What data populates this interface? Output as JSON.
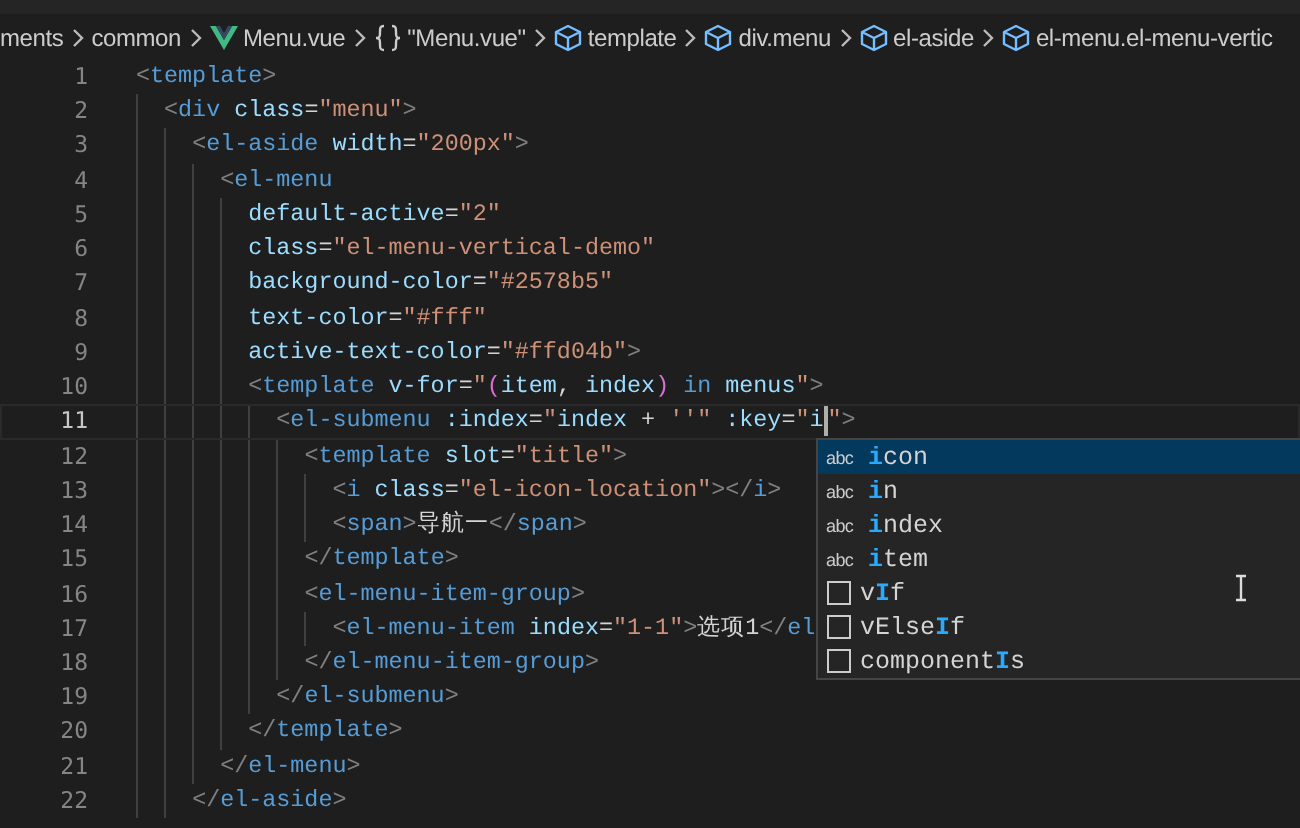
{
  "breadcrumbs": [
    {
      "kind": "text",
      "label": "ments"
    },
    {
      "kind": "text",
      "label": "common"
    },
    {
      "kind": "vue",
      "label": "Menu.vue"
    },
    {
      "kind": "braces",
      "label": "\"Menu.vue\""
    },
    {
      "kind": "symbol",
      "label": "template"
    },
    {
      "kind": "symbol",
      "label": "div.menu"
    },
    {
      "kind": "symbol",
      "label": "el-aside"
    },
    {
      "kind": "symbol",
      "label": "el-menu.el-menu-vertic"
    }
  ],
  "lines": [
    {
      "number": "1",
      "current": false,
      "tokens": [
        {
          "kind": "punct",
          "text": "<"
        },
        {
          "kind": "tag",
          "text": "template"
        },
        {
          "kind": "punct",
          "text": ">"
        }
      ]
    },
    {
      "number": "2",
      "current": false,
      "tokens": [
        {
          "kind": "punct",
          "text": "  <"
        },
        {
          "kind": "tag",
          "text": "div"
        },
        {
          "kind": "attr",
          "text": " class"
        },
        {
          "kind": "plain",
          "text": "="
        },
        {
          "kind": "string",
          "text": "\"menu\""
        },
        {
          "kind": "punct",
          "text": ">"
        }
      ]
    },
    {
      "number": "3",
      "current": false,
      "tokens": [
        {
          "kind": "punct",
          "text": "    <"
        },
        {
          "kind": "tag",
          "text": "el-aside"
        },
        {
          "kind": "attr",
          "text": " width"
        },
        {
          "kind": "plain",
          "text": "="
        },
        {
          "kind": "string",
          "text": "\"200px\""
        },
        {
          "kind": "punct",
          "text": ">"
        }
      ]
    },
    {
      "number": "4",
      "current": false,
      "tokens": [
        {
          "kind": "punct",
          "text": "      <"
        },
        {
          "kind": "tag",
          "text": "el-menu"
        }
      ]
    },
    {
      "number": "5",
      "current": false,
      "tokens": [
        {
          "kind": "attr",
          "text": "        default-active"
        },
        {
          "kind": "plain",
          "text": "="
        },
        {
          "kind": "string",
          "text": "\"2\""
        }
      ]
    },
    {
      "number": "6",
      "current": false,
      "tokens": [
        {
          "kind": "attr",
          "text": "        class"
        },
        {
          "kind": "plain",
          "text": "="
        },
        {
          "kind": "string",
          "text": "\"el-menu-vertical-demo\""
        }
      ]
    },
    {
      "number": "7",
      "current": false,
      "tokens": [
        {
          "kind": "attr",
          "text": "        background-color"
        },
        {
          "kind": "plain",
          "text": "="
        },
        {
          "kind": "string",
          "text": "\"#2578b5\""
        }
      ]
    },
    {
      "number": "8",
      "current": false,
      "tokens": [
        {
          "kind": "attr",
          "text": "        text-color"
        },
        {
          "kind": "plain",
          "text": "="
        },
        {
          "kind": "string",
          "text": "\"#fff\""
        }
      ]
    },
    {
      "number": "9",
      "current": false,
      "tokens": [
        {
          "kind": "attr",
          "text": "        active-text-color"
        },
        {
          "kind": "plain",
          "text": "="
        },
        {
          "kind": "string",
          "text": "\"#ffd04b\""
        },
        {
          "kind": "punct",
          "text": ">"
        }
      ]
    },
    {
      "number": "10",
      "current": false,
      "tokens": [
        {
          "kind": "punct",
          "text": "        <"
        },
        {
          "kind": "tag",
          "text": "template"
        },
        {
          "kind": "attr",
          "text": " v-for"
        },
        {
          "kind": "plain",
          "text": "="
        },
        {
          "kind": "string",
          "text": "\""
        },
        {
          "kind": "bracket",
          "text": "("
        },
        {
          "kind": "var",
          "text": "item"
        },
        {
          "kind": "plain",
          "text": ","
        },
        {
          "kind": "var",
          "text": " index"
        },
        {
          "kind": "bracket",
          "text": ")"
        },
        {
          "kind": "keyword",
          "text": " in"
        },
        {
          "kind": "var",
          "text": " menus"
        },
        {
          "kind": "string",
          "text": "\""
        },
        {
          "kind": "punct",
          "text": ">"
        }
      ]
    },
    {
      "number": "11",
      "current": true,
      "tokens": [
        {
          "kind": "punct",
          "text": "          <"
        },
        {
          "kind": "tag",
          "text": "el-submenu"
        },
        {
          "kind": "attr",
          "text": " :index"
        },
        {
          "kind": "plain",
          "text": "="
        },
        {
          "kind": "string",
          "text": "\""
        },
        {
          "kind": "var",
          "text": "index"
        },
        {
          "kind": "plain",
          "text": " + "
        },
        {
          "kind": "string",
          "text": "''"
        },
        {
          "kind": "string",
          "text": "\""
        },
        {
          "kind": "attr",
          "text": " :key"
        },
        {
          "kind": "plain",
          "text": "="
        },
        {
          "kind": "string",
          "text": "\""
        },
        {
          "kind": "var",
          "text": "i",
          "caret": true
        },
        {
          "kind": "string",
          "text": "\""
        },
        {
          "kind": "punct",
          "text": ">"
        }
      ]
    },
    {
      "number": "12",
      "current": false,
      "tokens": [
        {
          "kind": "punct",
          "text": "            <"
        },
        {
          "kind": "tag",
          "text": "template"
        },
        {
          "kind": "attr",
          "text": " slot"
        },
        {
          "kind": "plain",
          "text": "="
        },
        {
          "kind": "string",
          "text": "\"title\""
        },
        {
          "kind": "punct",
          "text": ">"
        }
      ]
    },
    {
      "number": "13",
      "current": false,
      "tokens": [
        {
          "kind": "punct",
          "text": "              <"
        },
        {
          "kind": "tag",
          "text": "i"
        },
        {
          "kind": "attr",
          "text": " class"
        },
        {
          "kind": "plain",
          "text": "="
        },
        {
          "kind": "string",
          "text": "\"el-icon-location\""
        },
        {
          "kind": "punct",
          "text": "></"
        },
        {
          "kind": "tag",
          "text": "i"
        },
        {
          "kind": "punct",
          "text": ">"
        }
      ]
    },
    {
      "number": "14",
      "current": false,
      "tokens": [
        {
          "kind": "punct",
          "text": "              <"
        },
        {
          "kind": "tag",
          "text": "span"
        },
        {
          "kind": "punct",
          "text": ">"
        },
        {
          "kind": "plain",
          "text": "导航一"
        },
        {
          "kind": "punct",
          "text": "</"
        },
        {
          "kind": "tag",
          "text": "span"
        },
        {
          "kind": "punct",
          "text": ">"
        }
      ]
    },
    {
      "number": "15",
      "current": false,
      "tokens": [
        {
          "kind": "punct",
          "text": "            </"
        },
        {
          "kind": "tag",
          "text": "template"
        },
        {
          "kind": "punct",
          "text": ">"
        }
      ]
    },
    {
      "number": "16",
      "current": false,
      "tokens": [
        {
          "kind": "punct",
          "text": "            <"
        },
        {
          "kind": "tag",
          "text": "el-menu-item-group"
        },
        {
          "kind": "punct",
          "text": ">"
        }
      ]
    },
    {
      "number": "17",
      "current": false,
      "tokens": [
        {
          "kind": "punct",
          "text": "              <"
        },
        {
          "kind": "tag",
          "text": "el-menu-item"
        },
        {
          "kind": "attr",
          "text": " index"
        },
        {
          "kind": "plain",
          "text": "="
        },
        {
          "kind": "string",
          "text": "\"1-1\""
        },
        {
          "kind": "punct",
          "text": ">"
        },
        {
          "kind": "plain",
          "text": "选项1"
        },
        {
          "kind": "punct",
          "text": "</"
        },
        {
          "kind": "tag",
          "text": "el"
        }
      ]
    },
    {
      "number": "18",
      "current": false,
      "tokens": [
        {
          "kind": "punct",
          "text": "            </"
        },
        {
          "kind": "tag",
          "text": "el-menu-item-group"
        },
        {
          "kind": "punct",
          "text": ">"
        }
      ]
    },
    {
      "number": "19",
      "current": false,
      "tokens": [
        {
          "kind": "punct",
          "text": "          </"
        },
        {
          "kind": "tag",
          "text": "el-submenu"
        },
        {
          "kind": "punct",
          "text": ">"
        }
      ]
    },
    {
      "number": "20",
      "current": false,
      "tokens": [
        {
          "kind": "punct",
          "text": "        </"
        },
        {
          "kind": "tag",
          "text": "template"
        },
        {
          "kind": "punct",
          "text": ">"
        }
      ]
    },
    {
      "number": "21",
      "current": false,
      "tokens": [
        {
          "kind": "punct",
          "text": "      </"
        },
        {
          "kind": "tag",
          "text": "el-menu"
        },
        {
          "kind": "punct",
          "text": ">"
        }
      ]
    },
    {
      "number": "22",
      "current": false,
      "tokens": [
        {
          "kind": "punct",
          "text": "    </"
        },
        {
          "kind": "tag",
          "text": "el-aside"
        },
        {
          "kind": "punct",
          "text": ">"
        }
      ]
    }
  ],
  "suggestions": [
    {
      "kind": "word",
      "icon_text": "abc",
      "label": "**i**con",
      "selected": true
    },
    {
      "kind": "word",
      "icon_text": "abc",
      "label": "**i**n",
      "selected": false
    },
    {
      "kind": "word",
      "icon_text": "abc",
      "label": "**i**ndex",
      "selected": false
    },
    {
      "kind": "word",
      "icon_text": "abc",
      "label": "**i**tem",
      "selected": false
    },
    {
      "kind": "snippet",
      "label": "v**I**f",
      "selected": false
    },
    {
      "kind": "snippet",
      "label": "vElse**I**f",
      "selected": false
    },
    {
      "kind": "snippet",
      "label": "component**I**s",
      "selected": false
    }
  ]
}
